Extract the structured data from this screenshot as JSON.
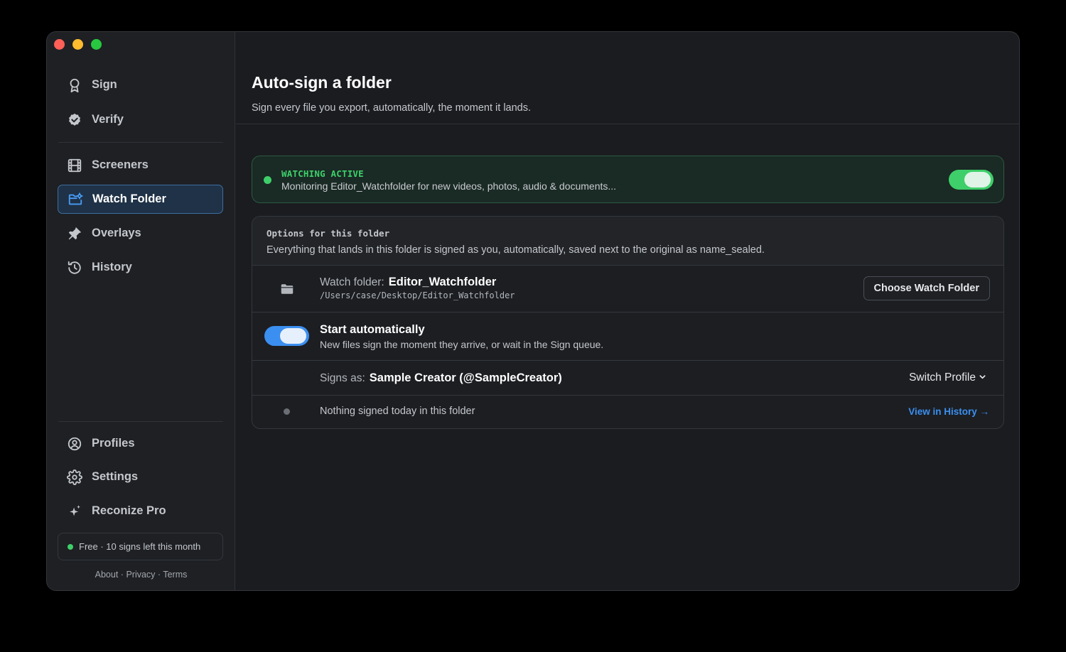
{
  "sidebar": {
    "nav_top": [
      {
        "label": "Sign",
        "icon": "award-icon"
      },
      {
        "label": "Verify",
        "icon": "verified-badge-icon"
      }
    ],
    "nav_mid": [
      {
        "label": "Screeners",
        "icon": "film-icon"
      },
      {
        "label": "Watch Folder",
        "icon": "folder-settings-icon",
        "active": true
      },
      {
        "label": "Overlays",
        "icon": "stamp-icon"
      },
      {
        "label": "History",
        "icon": "history-icon"
      }
    ],
    "nav_bottom": [
      {
        "label": "Profiles",
        "icon": "user-circle-icon"
      },
      {
        "label": "Settings",
        "icon": "gear-icon"
      },
      {
        "label": "Reconize Pro",
        "icon": "sparkles-icon"
      }
    ],
    "plan": "Free · 10 signs left this month",
    "footer": {
      "about": "About",
      "privacy": "Privacy",
      "terms": "Terms",
      "sep": "·"
    }
  },
  "main": {
    "title": "Auto-sign a folder",
    "subtitle": "Sign every file you export, automatically, the moment it lands.",
    "status": {
      "title": "WATCHING ACTIVE",
      "text": "Monitoring Editor_Watchfolder for new videos, photos, audio & documents...",
      "toggle_on": true
    },
    "options": {
      "title": "Options for this folder",
      "description": "Everything that lands in this folder is signed as you, automatically, saved next to the original as name_sealed.",
      "watch_folder": {
        "label": "Watch folder:",
        "name": "Editor_Watchfolder",
        "path": "/Users/case/Desktop/Editor_Watchfolder",
        "button": "Choose Watch Folder"
      },
      "start_auto": {
        "title": "Start automatically",
        "description": "New files sign the moment they arrive, or wait in the Sign queue.",
        "toggle_on": true
      },
      "signs_as": {
        "label": "Signs as:",
        "value": "Sample Creator (@SampleCreator)",
        "button": "Switch Profile"
      },
      "history": {
        "text": "Nothing signed today in this folder",
        "link": "View in History →"
      }
    }
  },
  "colors": {
    "accent_blue": "#3b8ff0",
    "status_green": "#3ecf6a",
    "window_bg": "#1a1c20"
  }
}
